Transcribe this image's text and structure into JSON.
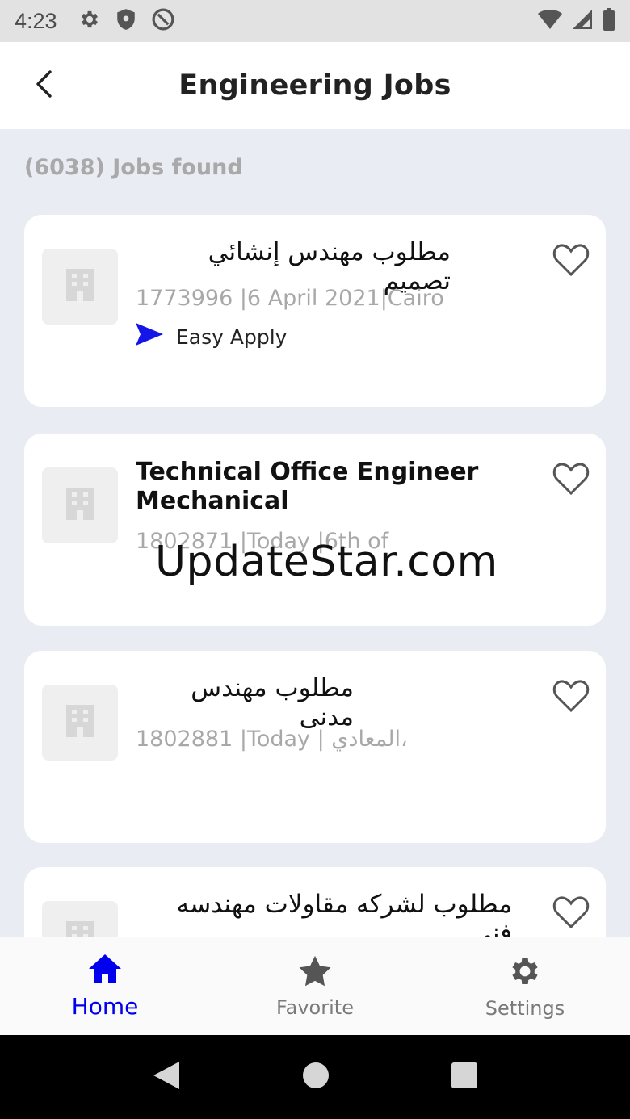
{
  "status_bar": {
    "time": "4:23",
    "icons": [
      "gear-icon",
      "shield-icon",
      "at-icon",
      "wifi-icon",
      "signal-icon",
      "battery-icon"
    ]
  },
  "header": {
    "title": "Engineering Jobs",
    "back_icon": "back-arrow-icon"
  },
  "jobs_count": "(6038) Jobs found",
  "jobs": [
    {
      "title": "مطلوب مهندس إنشائي تصميم",
      "rtl": true,
      "meta": "1773996 |6 April 2021|Cairo",
      "easy_apply": "Easy Apply"
    },
    {
      "title": "Technical Office Engineer Mechanical",
      "rtl": false,
      "meta": "1802871 |Today |6th of"
    },
    {
      "title": "مطلوب مهندس مدنى",
      "rtl": true,
      "meta": "1802881 |Today | المعادي،"
    },
    {
      "title": "مطلوب لشركه مقاولات مهندسه فني",
      "rtl": true,
      "meta": ""
    }
  ],
  "watermark": "UpdateStar.com",
  "bottom_nav": [
    {
      "label": "Home",
      "icon": "home-icon",
      "active": true
    },
    {
      "label": "Favorite",
      "icon": "star-icon",
      "active": false
    },
    {
      "label": "Settings",
      "icon": "gear-icon",
      "active": false
    }
  ],
  "colors": {
    "accent": "#0000ee",
    "background": "#e9edf3",
    "card": "#ffffff",
    "meta_text": "#a8a8a8",
    "easy_apply_arrow": "#1515e8"
  }
}
